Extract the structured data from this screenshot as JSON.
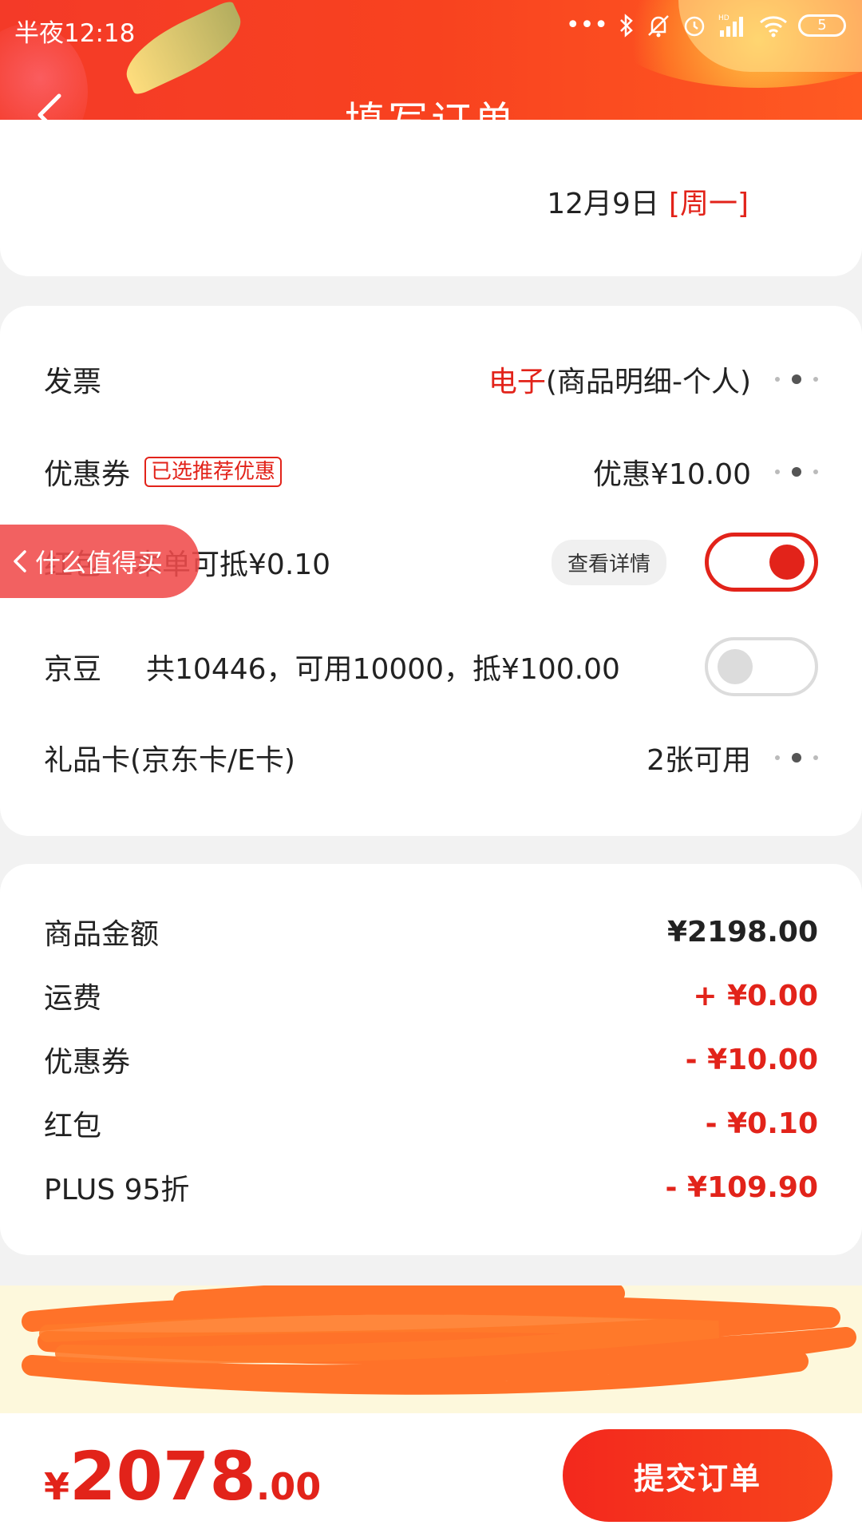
{
  "status_bar": {
    "time": "半夜12:18",
    "dots": "•••",
    "battery": "5"
  },
  "header": {
    "title": "填写订单"
  },
  "delivery": {
    "date": "12月9日",
    "weekday": "[周一]"
  },
  "options": {
    "invoice": {
      "label": "发票",
      "value_type": "电子",
      "value_detail": "(商品明细-个人)"
    },
    "coupon": {
      "label": "优惠券",
      "tag": "已选推荐优惠",
      "value": "优惠¥10.00"
    },
    "red_packet": {
      "label": "红包",
      "detail": "本单可抵¥0.10",
      "chip": "查看详情",
      "enabled": true
    },
    "jingdou": {
      "label": "京豆",
      "detail": "共10446，可用10000，抵¥100.00",
      "enabled": false
    },
    "gift_card": {
      "label": "礼品卡(京东卡/E卡)",
      "value": "2张可用"
    }
  },
  "floating_pill": {
    "label": "什么值得买"
  },
  "amounts": [
    {
      "label": "商品金额",
      "value": "¥2198.00"
    },
    {
      "label": "运费",
      "value": "+ ¥0.00"
    },
    {
      "label": "优惠券",
      "value": "- ¥10.00"
    },
    {
      "label": "红包",
      "value": "- ¥0.10"
    },
    {
      "label": "PLUS 95折",
      "value": "- ¥109.90"
    }
  ],
  "bottom": {
    "currency": "¥",
    "total_int": "2078",
    "total_dec": ".00",
    "submit_label": "提交订单"
  },
  "colors": {
    "accent_red": "#e2231a",
    "header_gradient_start": "#f43a28",
    "notice_bg": "#fdf8dc",
    "scribble": "#ff6a1f"
  }
}
